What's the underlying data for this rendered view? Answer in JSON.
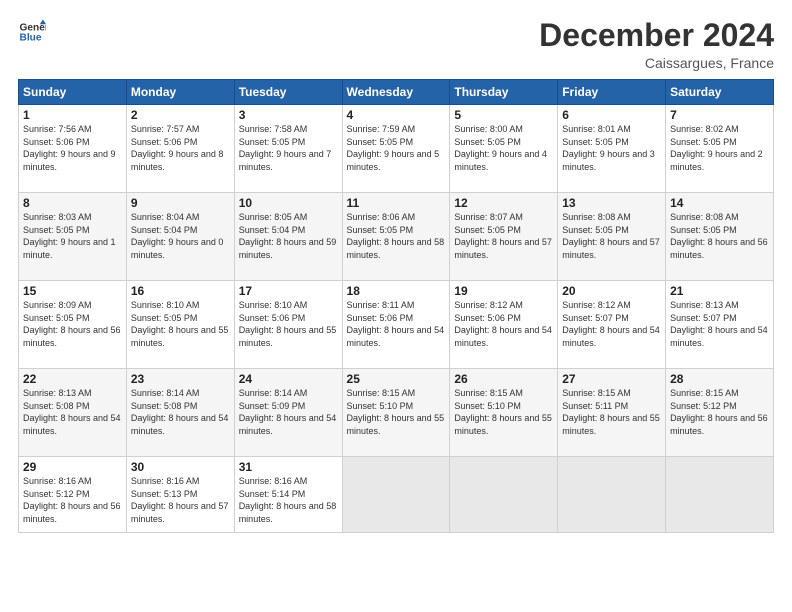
{
  "logo": {
    "line1": "General",
    "line2": "Blue"
  },
  "header": {
    "month": "December 2024",
    "location": "Caissargues, France"
  },
  "weekdays": [
    "Sunday",
    "Monday",
    "Tuesday",
    "Wednesday",
    "Thursday",
    "Friday",
    "Saturday"
  ],
  "weeks": [
    [
      {
        "day": "1",
        "sunrise": "Sunrise: 7:56 AM",
        "sunset": "Sunset: 5:06 PM",
        "daylight": "Daylight: 9 hours and 9 minutes."
      },
      {
        "day": "2",
        "sunrise": "Sunrise: 7:57 AM",
        "sunset": "Sunset: 5:06 PM",
        "daylight": "Daylight: 9 hours and 8 minutes."
      },
      {
        "day": "3",
        "sunrise": "Sunrise: 7:58 AM",
        "sunset": "Sunset: 5:05 PM",
        "daylight": "Daylight: 9 hours and 7 minutes."
      },
      {
        "day": "4",
        "sunrise": "Sunrise: 7:59 AM",
        "sunset": "Sunset: 5:05 PM",
        "daylight": "Daylight: 9 hours and 5 minutes."
      },
      {
        "day": "5",
        "sunrise": "Sunrise: 8:00 AM",
        "sunset": "Sunset: 5:05 PM",
        "daylight": "Daylight: 9 hours and 4 minutes."
      },
      {
        "day": "6",
        "sunrise": "Sunrise: 8:01 AM",
        "sunset": "Sunset: 5:05 PM",
        "daylight": "Daylight: 9 hours and 3 minutes."
      },
      {
        "day": "7",
        "sunrise": "Sunrise: 8:02 AM",
        "sunset": "Sunset: 5:05 PM",
        "daylight": "Daylight: 9 hours and 2 minutes."
      }
    ],
    [
      {
        "day": "8",
        "sunrise": "Sunrise: 8:03 AM",
        "sunset": "Sunset: 5:05 PM",
        "daylight": "Daylight: 9 hours and 1 minute."
      },
      {
        "day": "9",
        "sunrise": "Sunrise: 8:04 AM",
        "sunset": "Sunset: 5:04 PM",
        "daylight": "Daylight: 9 hours and 0 minutes."
      },
      {
        "day": "10",
        "sunrise": "Sunrise: 8:05 AM",
        "sunset": "Sunset: 5:04 PM",
        "daylight": "Daylight: 8 hours and 59 minutes."
      },
      {
        "day": "11",
        "sunrise": "Sunrise: 8:06 AM",
        "sunset": "Sunset: 5:05 PM",
        "daylight": "Daylight: 8 hours and 58 minutes."
      },
      {
        "day": "12",
        "sunrise": "Sunrise: 8:07 AM",
        "sunset": "Sunset: 5:05 PM",
        "daylight": "Daylight: 8 hours and 57 minutes."
      },
      {
        "day": "13",
        "sunrise": "Sunrise: 8:08 AM",
        "sunset": "Sunset: 5:05 PM",
        "daylight": "Daylight: 8 hours and 57 minutes."
      },
      {
        "day": "14",
        "sunrise": "Sunrise: 8:08 AM",
        "sunset": "Sunset: 5:05 PM",
        "daylight": "Daylight: 8 hours and 56 minutes."
      }
    ],
    [
      {
        "day": "15",
        "sunrise": "Sunrise: 8:09 AM",
        "sunset": "Sunset: 5:05 PM",
        "daylight": "Daylight: 8 hours and 56 minutes."
      },
      {
        "day": "16",
        "sunrise": "Sunrise: 8:10 AM",
        "sunset": "Sunset: 5:05 PM",
        "daylight": "Daylight: 8 hours and 55 minutes."
      },
      {
        "day": "17",
        "sunrise": "Sunrise: 8:10 AM",
        "sunset": "Sunset: 5:06 PM",
        "daylight": "Daylight: 8 hours and 55 minutes."
      },
      {
        "day": "18",
        "sunrise": "Sunrise: 8:11 AM",
        "sunset": "Sunset: 5:06 PM",
        "daylight": "Daylight: 8 hours and 54 minutes."
      },
      {
        "day": "19",
        "sunrise": "Sunrise: 8:12 AM",
        "sunset": "Sunset: 5:06 PM",
        "daylight": "Daylight: 8 hours and 54 minutes."
      },
      {
        "day": "20",
        "sunrise": "Sunrise: 8:12 AM",
        "sunset": "Sunset: 5:07 PM",
        "daylight": "Daylight: 8 hours and 54 minutes."
      },
      {
        "day": "21",
        "sunrise": "Sunrise: 8:13 AM",
        "sunset": "Sunset: 5:07 PM",
        "daylight": "Daylight: 8 hours and 54 minutes."
      }
    ],
    [
      {
        "day": "22",
        "sunrise": "Sunrise: 8:13 AM",
        "sunset": "Sunset: 5:08 PM",
        "daylight": "Daylight: 8 hours and 54 minutes."
      },
      {
        "day": "23",
        "sunrise": "Sunrise: 8:14 AM",
        "sunset": "Sunset: 5:08 PM",
        "daylight": "Daylight: 8 hours and 54 minutes."
      },
      {
        "day": "24",
        "sunrise": "Sunrise: 8:14 AM",
        "sunset": "Sunset: 5:09 PM",
        "daylight": "Daylight: 8 hours and 54 minutes."
      },
      {
        "day": "25",
        "sunrise": "Sunrise: 8:15 AM",
        "sunset": "Sunset: 5:10 PM",
        "daylight": "Daylight: 8 hours and 55 minutes."
      },
      {
        "day": "26",
        "sunrise": "Sunrise: 8:15 AM",
        "sunset": "Sunset: 5:10 PM",
        "daylight": "Daylight: 8 hours and 55 minutes."
      },
      {
        "day": "27",
        "sunrise": "Sunrise: 8:15 AM",
        "sunset": "Sunset: 5:11 PM",
        "daylight": "Daylight: 8 hours and 55 minutes."
      },
      {
        "day": "28",
        "sunrise": "Sunrise: 8:15 AM",
        "sunset": "Sunset: 5:12 PM",
        "daylight": "Daylight: 8 hours and 56 minutes."
      }
    ],
    [
      {
        "day": "29",
        "sunrise": "Sunrise: 8:16 AM",
        "sunset": "Sunset: 5:12 PM",
        "daylight": "Daylight: 8 hours and 56 minutes."
      },
      {
        "day": "30",
        "sunrise": "Sunrise: 8:16 AM",
        "sunset": "Sunset: 5:13 PM",
        "daylight": "Daylight: 8 hours and 57 minutes."
      },
      {
        "day": "31",
        "sunrise": "Sunrise: 8:16 AM",
        "sunset": "Sunset: 5:14 PM",
        "daylight": "Daylight: 8 hours and 58 minutes."
      },
      null,
      null,
      null,
      null
    ]
  ]
}
